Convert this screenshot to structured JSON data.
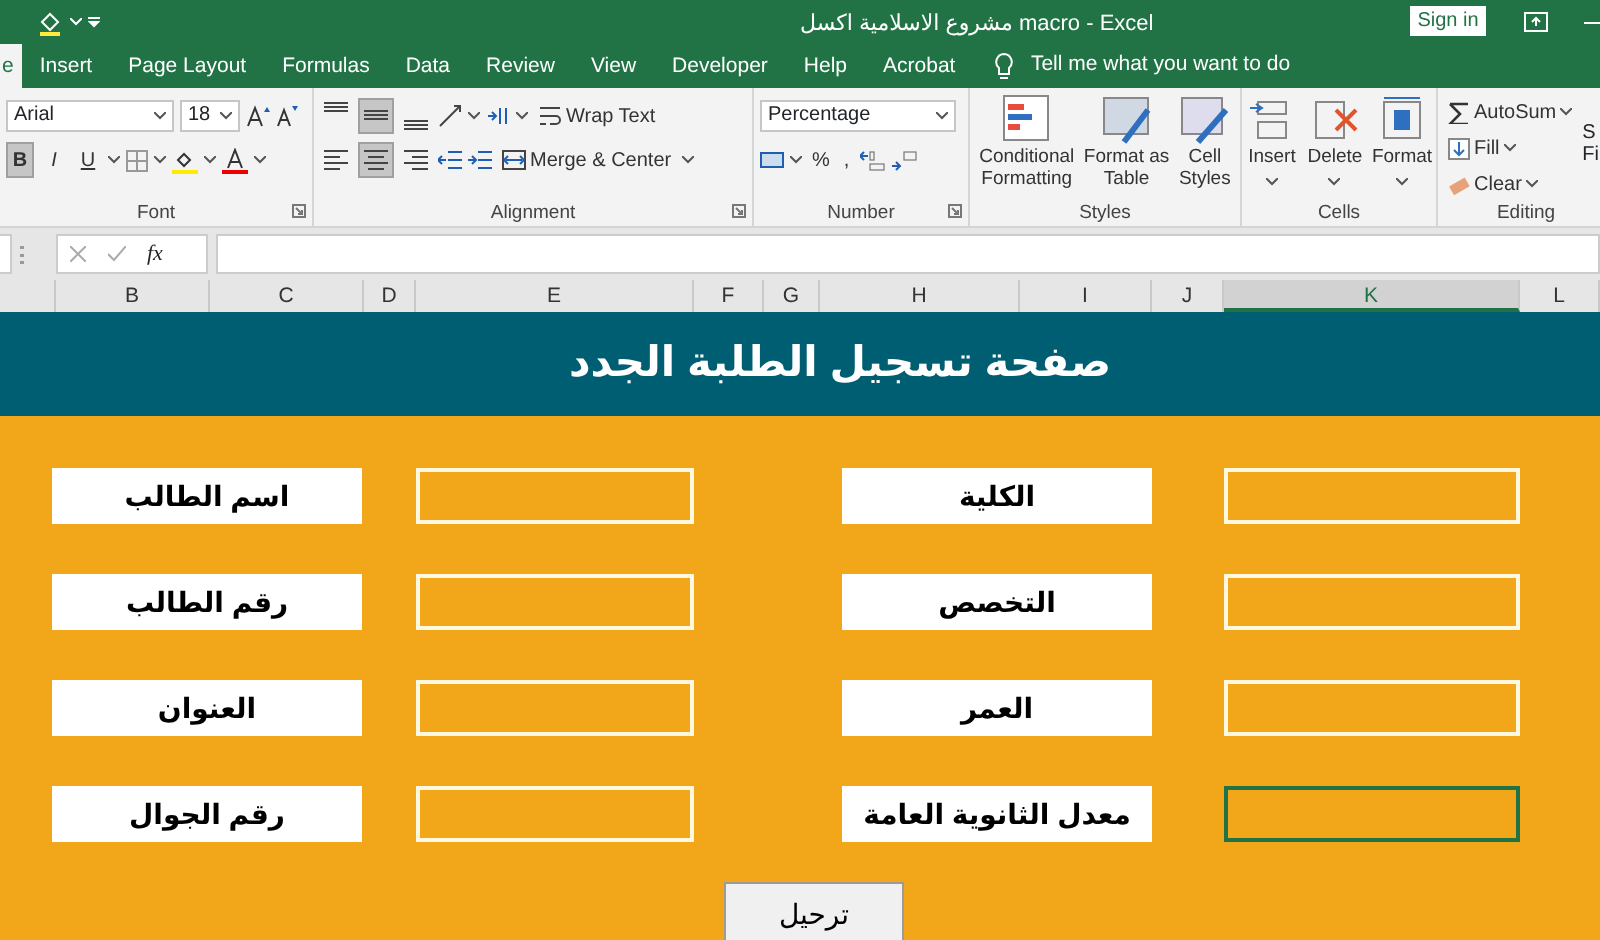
{
  "window": {
    "title": "مشروع الاسلامية اكسل macro  -  Excel",
    "sign_in": "Sign in"
  },
  "tabs": [
    {
      "label": "e",
      "selected": true
    },
    {
      "label": "Insert",
      "selected": false
    },
    {
      "label": "Page Layout",
      "selected": false
    },
    {
      "label": "Formulas",
      "selected": false
    },
    {
      "label": "Data",
      "selected": false
    },
    {
      "label": "Review",
      "selected": false
    },
    {
      "label": "View",
      "selected": false
    },
    {
      "label": "Developer",
      "selected": false
    },
    {
      "label": "Help",
      "selected": false
    },
    {
      "label": "Acrobat",
      "selected": false
    }
  ],
  "tell_me": "Tell me what you want to do",
  "ribbon": {
    "font": {
      "label": "Font",
      "font_name": "Arial",
      "font_size": "18",
      "styles": [
        {
          "text": "B",
          "kind": "bold",
          "selected": true
        },
        {
          "text": "I",
          "kind": "italic",
          "selected": false
        },
        {
          "text": "U",
          "kind": "underline",
          "selected": false
        }
      ]
    },
    "alignment": {
      "label": "Alignment",
      "vertical": [
        {
          "selected": false
        },
        {
          "selected": true
        },
        {
          "selected": false
        }
      ],
      "horizontal": [
        {
          "selected": false
        },
        {
          "selected": true
        },
        {
          "selected": false
        }
      ],
      "wrap_text": "Wrap Text",
      "merge": "Merge & Center"
    },
    "number": {
      "label": "Number",
      "format": "Percentage",
      "percent": "%",
      "comma": ","
    },
    "styles": {
      "label": "Styles",
      "buttons": [
        [
          "Conditional",
          "Formatting"
        ],
        [
          "Format as",
          "Table"
        ],
        [
          "Cell",
          "Styles"
        ]
      ]
    },
    "cells": {
      "label": "Cells",
      "buttons": [
        "Insert",
        "Delete",
        "Format"
      ]
    },
    "editing": {
      "label": "Editing",
      "buttons": [
        "AutoSum",
        "Fill",
        "Clear"
      ],
      "cut_button": [
        "S",
        "Fi"
      ]
    }
  },
  "formula_bar": {
    "function_label": "fx"
  },
  "columns": [
    {
      "label": "B",
      "selected": false
    },
    {
      "label": "C",
      "selected": false
    },
    {
      "label": "D",
      "selected": false
    },
    {
      "label": "E",
      "selected": false
    },
    {
      "label": "F",
      "selected": false
    },
    {
      "label": "G",
      "selected": false
    },
    {
      "label": "H",
      "selected": false
    },
    {
      "label": "I",
      "selected": false
    },
    {
      "label": "J",
      "selected": false
    },
    {
      "label": "K",
      "selected": true
    },
    {
      "label": "L",
      "selected": false
    }
  ],
  "sheet": {
    "title": "صفحة تسجيل الطلبة الجدد",
    "rows": [
      {
        "left_label": "اسم الطالب",
        "left_field": {
          "selected": false
        },
        "right_label": "الكلية",
        "right_field": {
          "selected": false
        }
      },
      {
        "left_label": "رقم الطالب",
        "left_field": {
          "selected": false
        },
        "right_label": "التخصص",
        "right_field": {
          "selected": false
        }
      },
      {
        "left_label": "العنوان",
        "left_field": {
          "selected": false
        },
        "right_label": "العمر",
        "right_field": {
          "selected": false
        }
      },
      {
        "left_label": "رقم الجوال",
        "left_field": {
          "selected": false
        },
        "right_label": "معدل الثانوية العامة",
        "right_field": {
          "selected": true
        }
      }
    ],
    "button": "ترحيل"
  }
}
